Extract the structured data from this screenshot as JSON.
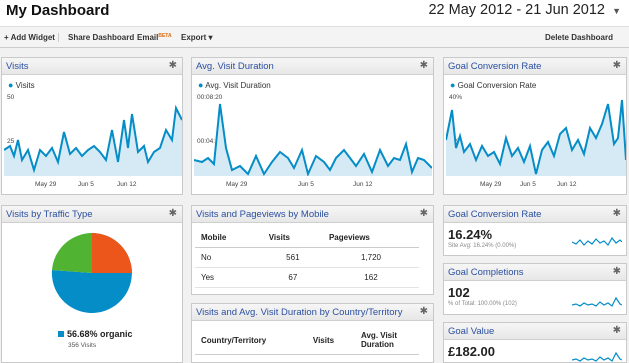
{
  "header": {
    "title": "My Dashboard",
    "date_range": "22 May 2012 - 21 Jun 2012"
  },
  "toolbar": {
    "add_widget": "+ Add Widget",
    "share": "Share Dashboard",
    "email": "Email",
    "beta": "BETA",
    "export": "Export ▾",
    "delete": "Delete Dashboard"
  },
  "visits": {
    "title": "Visits",
    "legend": "Visits",
    "y_top": "50",
    "y_mid": "25",
    "x_ticks": [
      "May 29",
      "Jun 5",
      "Jun 12"
    ]
  },
  "avd": {
    "title": "Avg. Visit Duration",
    "legend": "Avg. Visit Duration",
    "y_top": "00:08:20",
    "y_mid": "00:04:10",
    "x_ticks": [
      "May 29",
      "Jun 5",
      "Jun 12"
    ]
  },
  "gcr": {
    "title": "Goal Conversion Rate",
    "legend": "Goal Conversion Rate",
    "y_top": "40%",
    "y_mid": "20%",
    "x_ticks": [
      "May 29",
      "Jun 5",
      "Jun 12"
    ]
  },
  "traffic": {
    "title": "Visits by Traffic Type",
    "legend_label": "56.68% organic",
    "legend_sub": "356 Visits"
  },
  "mobile": {
    "title": "Visits and Pageviews by Mobile",
    "columns": [
      "Mobile",
      "Visits",
      "Pageviews"
    ],
    "rows": [
      [
        "No",
        "561",
        "1,720"
      ],
      [
        "Yes",
        "67",
        "162"
      ]
    ]
  },
  "country": {
    "title": "Visits and Avg. Visit Duration by Country/Territory",
    "columns": [
      "Country/Territory",
      "Visits",
      "Avg. Visit Duration"
    ]
  },
  "gcr_small": {
    "title": "Goal Conversion Rate",
    "value": "16.24%",
    "sub": "Site Avg: 16.24% (0.00%)"
  },
  "completions": {
    "title": "Goal Completions",
    "value": "102",
    "sub": "% of Total: 100.00% (102)"
  },
  "goalvalue": {
    "title": "Goal Value",
    "value": "£182.00"
  },
  "colors": {
    "accent": "#058dc7",
    "fill": "#d6eaf6",
    "green": "#50b432",
    "orange": "#ed561b"
  }
}
